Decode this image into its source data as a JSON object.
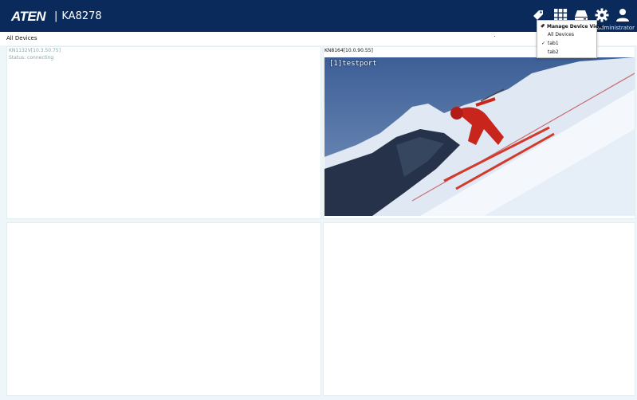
{
  "header": {
    "logo": "ATEN",
    "separator": "|",
    "model": "KA8278",
    "welcome_text": "me administrator",
    "icons": [
      "tag-icon",
      "grid-icon",
      "device-icon",
      "gear-icon",
      "user-icon"
    ],
    "bar_color": "#0a2a5c"
  },
  "breadcrumb": "All Devices",
  "panels": [
    {
      "device": "KN1132V[10.3.50.75]",
      "status": "Status: connecting"
    },
    {
      "device": "KN8164[10.0.90.55]",
      "port_label": "[1]testport"
    },
    {},
    {}
  ],
  "menu": {
    "header": "Manage Device View",
    "items": [
      {
        "label": "All Devices",
        "checked": false
      },
      {
        "label": "tab1",
        "checked": true
      },
      {
        "label": "tab2",
        "checked": false
      }
    ],
    "check_mark": "✓"
  }
}
